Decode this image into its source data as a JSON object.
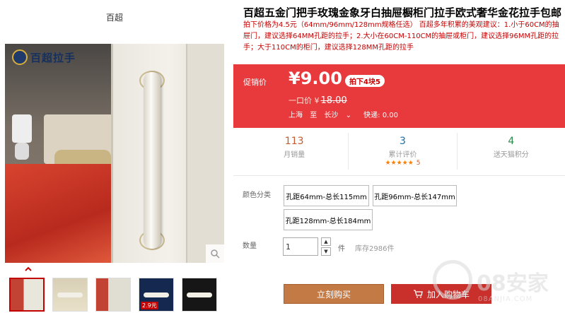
{
  "store": {
    "name": "百超"
  },
  "main_image": {
    "logo_text": "百超拉手",
    "zoom_icon": "search-icon"
  },
  "thumbnails": [
    {
      "label": ""
    },
    {
      "label": ""
    },
    {
      "label": ""
    },
    {
      "label": "2.9元"
    },
    {
      "label": ""
    }
  ],
  "product": {
    "title": "百超五金门把手玫瑰金象牙白抽屉橱柜门拉手欧式奢华金花拉手包邮",
    "subtitle": "拍下价格为4.5元（64mm/96mm/128mm规格任选） 百超多年积累的美观建议：1.小于60CM的抽屉门，建议选择64MM孔距的拉手；2.大小在60CM-110CM的抽屉或柜门，建议选择96MM孔距的拉手；大于110CM的柜门，建议选择128MM孔距的拉手"
  },
  "price": {
    "promo_label": "促销价",
    "currency": "¥",
    "amount": "9.00",
    "promo_tag": "拍下4块5",
    "original_label": "一口价",
    "original_currency": "¥",
    "original_amount": "18.00",
    "ship_from": "上海",
    "ship_to_prefix": "至",
    "ship_to": "长沙",
    "shipping": "快递: 0.00"
  },
  "stats": [
    {
      "value": "113",
      "label": "月销量"
    },
    {
      "value": "3",
      "label": "累计评价",
      "stars": "★★★★★",
      "rating_count": "5"
    },
    {
      "value": "4",
      "label": "送天猫积分"
    }
  ],
  "options": {
    "color_label": "颜色分类",
    "skus": [
      "孔距64mm-总长115mm",
      "孔距96mm-总长147mm",
      "孔距128mm-总长184mm"
    ]
  },
  "quantity": {
    "label": "数量",
    "value": "1",
    "unit": "件",
    "stock": "库存2986件"
  },
  "actions": {
    "buy_now": "立刻购买",
    "add_to_cart": "加入购物车"
  },
  "watermark": {
    "text": "08安家",
    "url": "08ANJIA.COM"
  },
  "colors": {
    "price_bg": "#e8393c",
    "buy_bg": "#c47a45",
    "cart_bg": "#c9302c",
    "accent": "#c40000"
  }
}
